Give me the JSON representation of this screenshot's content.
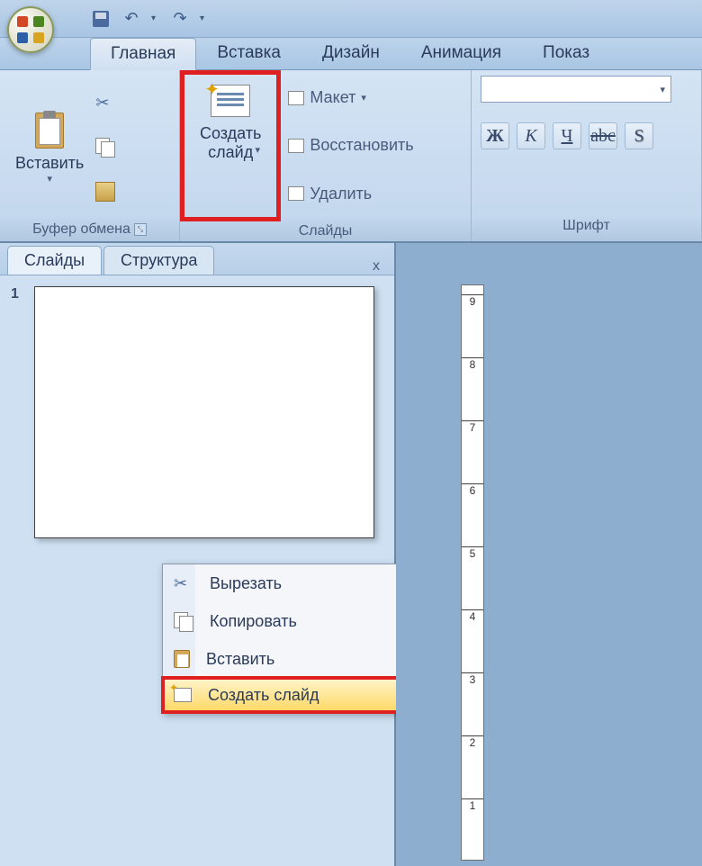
{
  "qat": {
    "dropdownGlyph": "▾"
  },
  "tabs": [
    "Главная",
    "Вставка",
    "Дизайн",
    "Анимация",
    "Показ"
  ],
  "ribbon": {
    "clipboard": {
      "paste": "Вставить",
      "pasteArrow": "▾",
      "groupLabel": "Буфер обмена"
    },
    "slides": {
      "newSlide": "Создать\nслайд",
      "newSlideArrow": "▾",
      "layout": "Макет",
      "layoutArrow": "▾",
      "reset": "Восстановить",
      "delete": "Удалить",
      "groupLabel": "Слайды"
    },
    "font": {
      "dropdownGlyph": "▾",
      "bold": "Ж",
      "italic": "К",
      "underline": "Ч",
      "strike": "abc",
      "shadow": "S",
      "groupLabel": "Шрифт"
    }
  },
  "panel": {
    "tabSlides": "Слайды",
    "tabStructure": "Структура",
    "close": "x",
    "slideNumber": "1"
  },
  "context": {
    "cut": "Вырезать",
    "copy": "Копировать",
    "paste": "Вставить",
    "newSlide": "Создать слайд"
  },
  "ruler": {
    "ticks": [
      "9",
      "8",
      "7",
      "6",
      "5",
      "4",
      "3",
      "2",
      "1"
    ]
  }
}
